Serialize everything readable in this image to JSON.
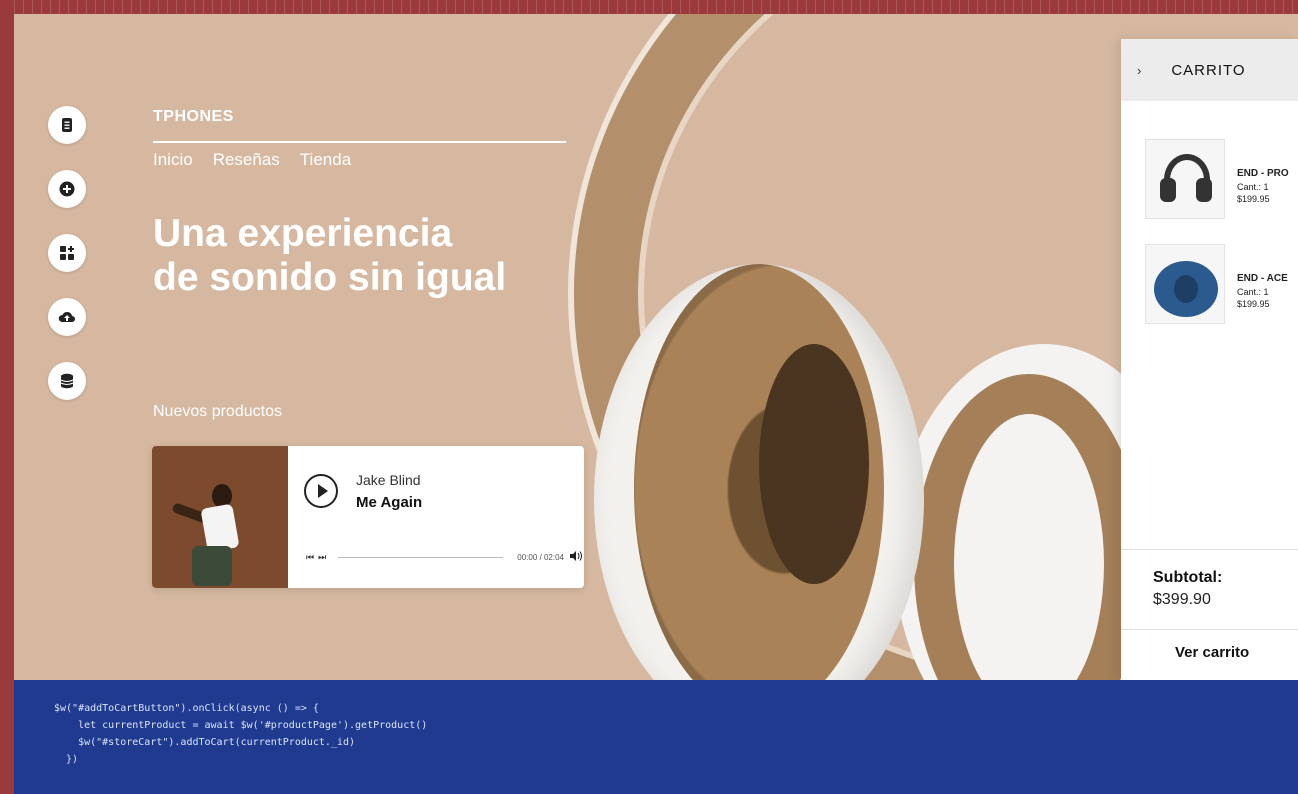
{
  "brand": "TPHONES",
  "nav": [
    "Inicio",
    "Reseñas",
    "Tienda"
  ],
  "hero": {
    "line1": "Una experiencia",
    "line2": "de sonido sin igual"
  },
  "section_title": "Nuevos productos",
  "player": {
    "artist": "Jake Blind",
    "track": "Me Again",
    "prev_label": "⏮",
    "next_label": "⏭",
    "time": "00:00 / 02:04",
    "volume_icon": "volume-icon"
  },
  "sidebar_icons": [
    "document-icon",
    "add-circle-icon",
    "add-apps-icon",
    "cloud-upload-icon",
    "database-icon"
  ],
  "cart": {
    "title": "CARRITO",
    "items": [
      {
        "name": "END - PRO",
        "qty": "Cant.: 1",
        "price": "$199.95",
        "thumb": "black-headphones-thumb"
      },
      {
        "name": "END - ACE",
        "qty": "Cant.: 1",
        "price": "$199.95",
        "thumb": "blue-headphones-thumb"
      }
    ],
    "subtotal_label": "Subtotal:",
    "subtotal_value": "$399.90",
    "view_cart_label": "Ver carrito"
  },
  "code": {
    "line1": "$w(\"#addToCartButton\").onClick(async () => {",
    "line2": "    let currentProduct = await $w('#productPage').getProduct()",
    "line3": "    $w(\"#storeCart\").addToCart(currentProduct._id)",
    "line4": "  })"
  },
  "colors": {
    "frame": "#9b3a3c",
    "stage_bg": "#d6b8a0",
    "code_bg": "#1f3a8f"
  }
}
